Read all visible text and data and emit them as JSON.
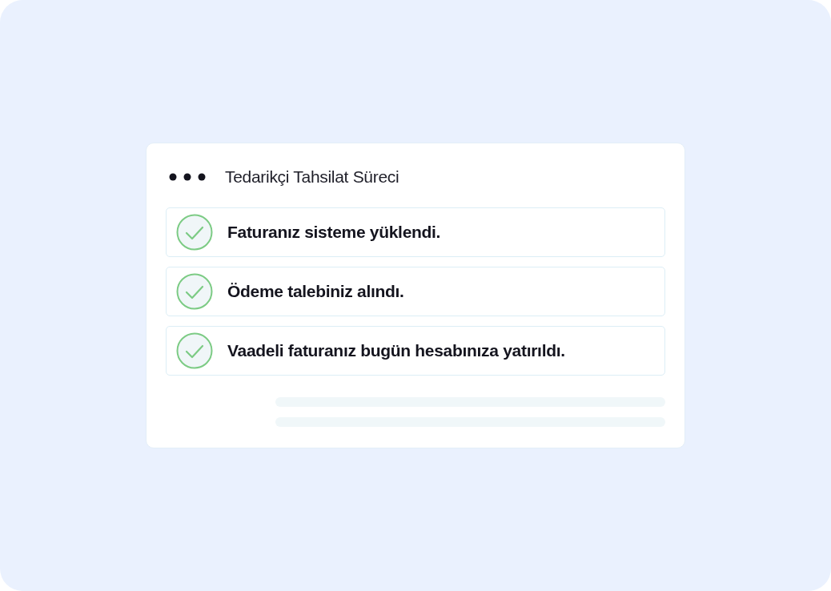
{
  "card": {
    "title": "Tedarikçi Tahsilat Süreci"
  },
  "steps": [
    {
      "text": "Faturanız sisteme yüklendi.",
      "done": true
    },
    {
      "text": "Ödeme talebiniz alındı.",
      "done": true
    },
    {
      "text": "Vaadeli faturanız bugün hesabınıza yatırıldı.",
      "done": true
    }
  ]
}
